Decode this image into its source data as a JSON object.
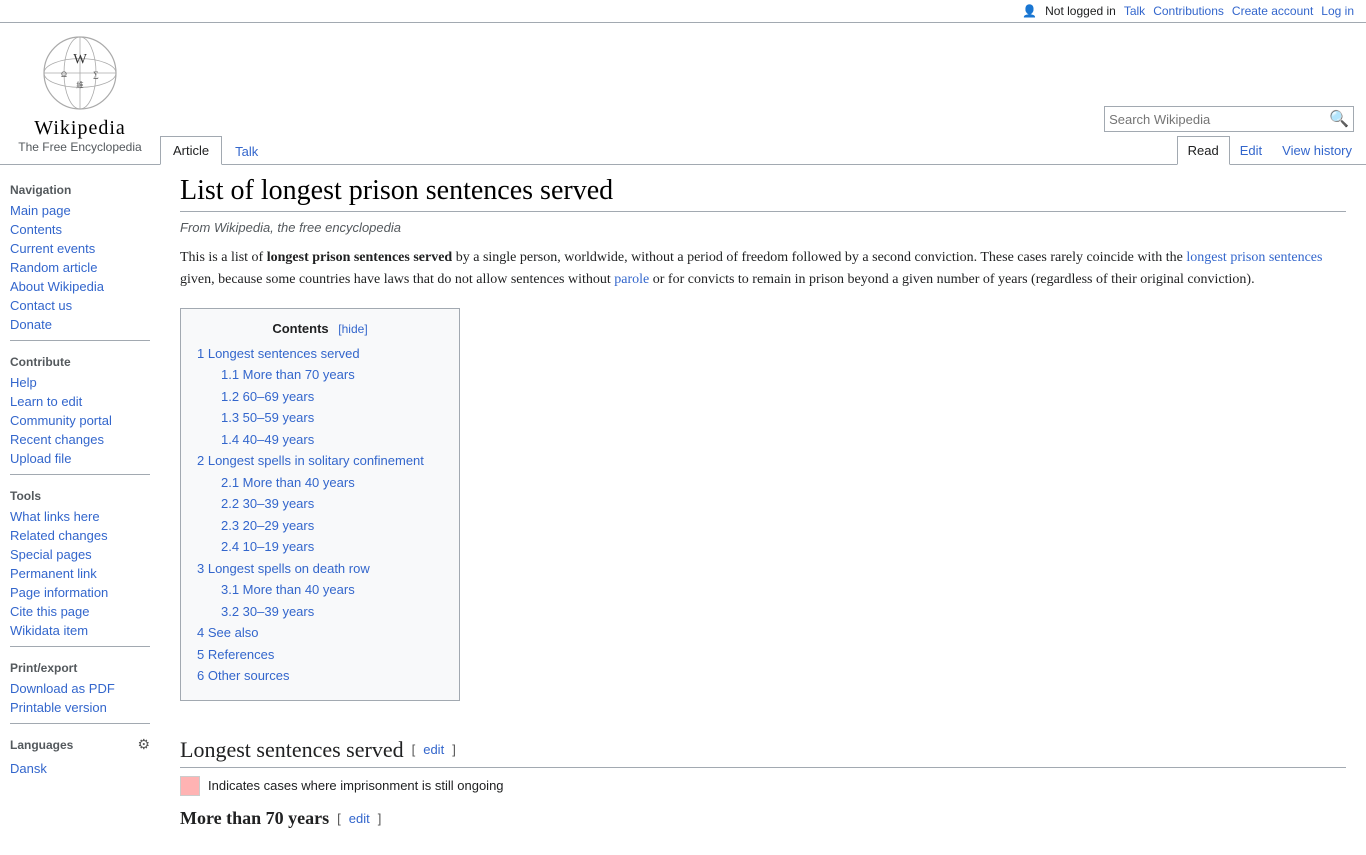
{
  "topbar": {
    "not_logged_in": "Not logged in",
    "talk": "Talk",
    "contributions": "Contributions",
    "create_account": "Create account",
    "log_in": "Log in"
  },
  "logo": {
    "title": "Wikipedia",
    "subtitle": "The Free Encyclopedia"
  },
  "tabs": {
    "article": "Article",
    "talk": "Talk",
    "read": "Read",
    "edit": "Edit",
    "view_history": "View history"
  },
  "search": {
    "placeholder": "Search Wikipedia"
  },
  "sidebar": {
    "navigation_title": "Navigation",
    "main_page": "Main page",
    "contents": "Contents",
    "current_events": "Current events",
    "random_article": "Random article",
    "about_wikipedia": "About Wikipedia",
    "contact_us": "Contact us",
    "donate": "Donate",
    "contribute_title": "Contribute",
    "help": "Help",
    "learn_to_edit": "Learn to edit",
    "community_portal": "Community portal",
    "recent_changes": "Recent changes",
    "upload_file": "Upload file",
    "tools_title": "Tools",
    "what_links_here": "What links here",
    "related_changes": "Related changes",
    "special_pages": "Special pages",
    "permanent_link": "Permanent link",
    "page_information": "Page information",
    "cite_this_page": "Cite this page",
    "wikidata_item": "Wikidata item",
    "print_title": "Print/export",
    "download_pdf": "Download as PDF",
    "printable_version": "Printable version",
    "languages_title": "Languages",
    "dansk": "Dansk"
  },
  "page": {
    "title": "List of longest prison sentences served",
    "subtitle": "From Wikipedia, the free encyclopedia",
    "intro_bold": "longest prison sentences served",
    "intro_text1": "This is a list of ",
    "intro_text2": " by a single person, worldwide, without a period of freedom followed by a second conviction. These cases rarely coincide with the ",
    "intro_link1": "longest prison sentences",
    "intro_text3": " given, because some countries have laws that do not allow sentences without ",
    "intro_link2": "parole",
    "intro_text4": " or for convicts to remain in prison beyond a given number of years (regardless of their original conviction)."
  },
  "toc": {
    "title": "Contents",
    "hide_label": "[hide]",
    "items": [
      {
        "num": "1",
        "label": "Longest sentences served",
        "anchor": "longest-sentences-served"
      },
      {
        "num": "1.1",
        "label": "More than 70 years",
        "anchor": "more-than-70-years",
        "sub": true
      },
      {
        "num": "1.2",
        "label": "60–69 years",
        "anchor": "60-69-years",
        "sub": true
      },
      {
        "num": "1.3",
        "label": "50–59 years",
        "anchor": "50-59-years",
        "sub": true
      },
      {
        "num": "1.4",
        "label": "40–49 years",
        "anchor": "40-49-years",
        "sub": true
      },
      {
        "num": "2",
        "label": "Longest spells in solitary confinement",
        "anchor": "longest-spells-solitary"
      },
      {
        "num": "2.1",
        "label": "More than 40 years",
        "anchor": "more-than-40-years",
        "sub": true
      },
      {
        "num": "2.2",
        "label": "30–39 years",
        "anchor": "30-39-years",
        "sub": true
      },
      {
        "num": "2.3",
        "label": "20–29 years",
        "anchor": "20-29-years",
        "sub": true
      },
      {
        "num": "2.4",
        "label": "10–19 years",
        "anchor": "10-19-years",
        "sub": true
      },
      {
        "num": "3",
        "label": "Longest spells on death row",
        "anchor": "longest-spells-death-row"
      },
      {
        "num": "3.1",
        "label": "More than 40 years",
        "anchor": "more-than-40-years-death-row",
        "sub": true
      },
      {
        "num": "3.2",
        "label": "30–39 years",
        "anchor": "30-39-years-death-row",
        "sub": true
      },
      {
        "num": "4",
        "label": "See also",
        "anchor": "see-also"
      },
      {
        "num": "5",
        "label": "References",
        "anchor": "references"
      },
      {
        "num": "6",
        "label": "Other sources",
        "anchor": "other-sources"
      }
    ]
  },
  "sections": {
    "longest_sentences_served": "Longest sentences served",
    "edit_label": "edit",
    "more_than_70_years": "More than 70 years",
    "ongoing_text": "Indicates cases where imprisonment is still ongoing"
  }
}
